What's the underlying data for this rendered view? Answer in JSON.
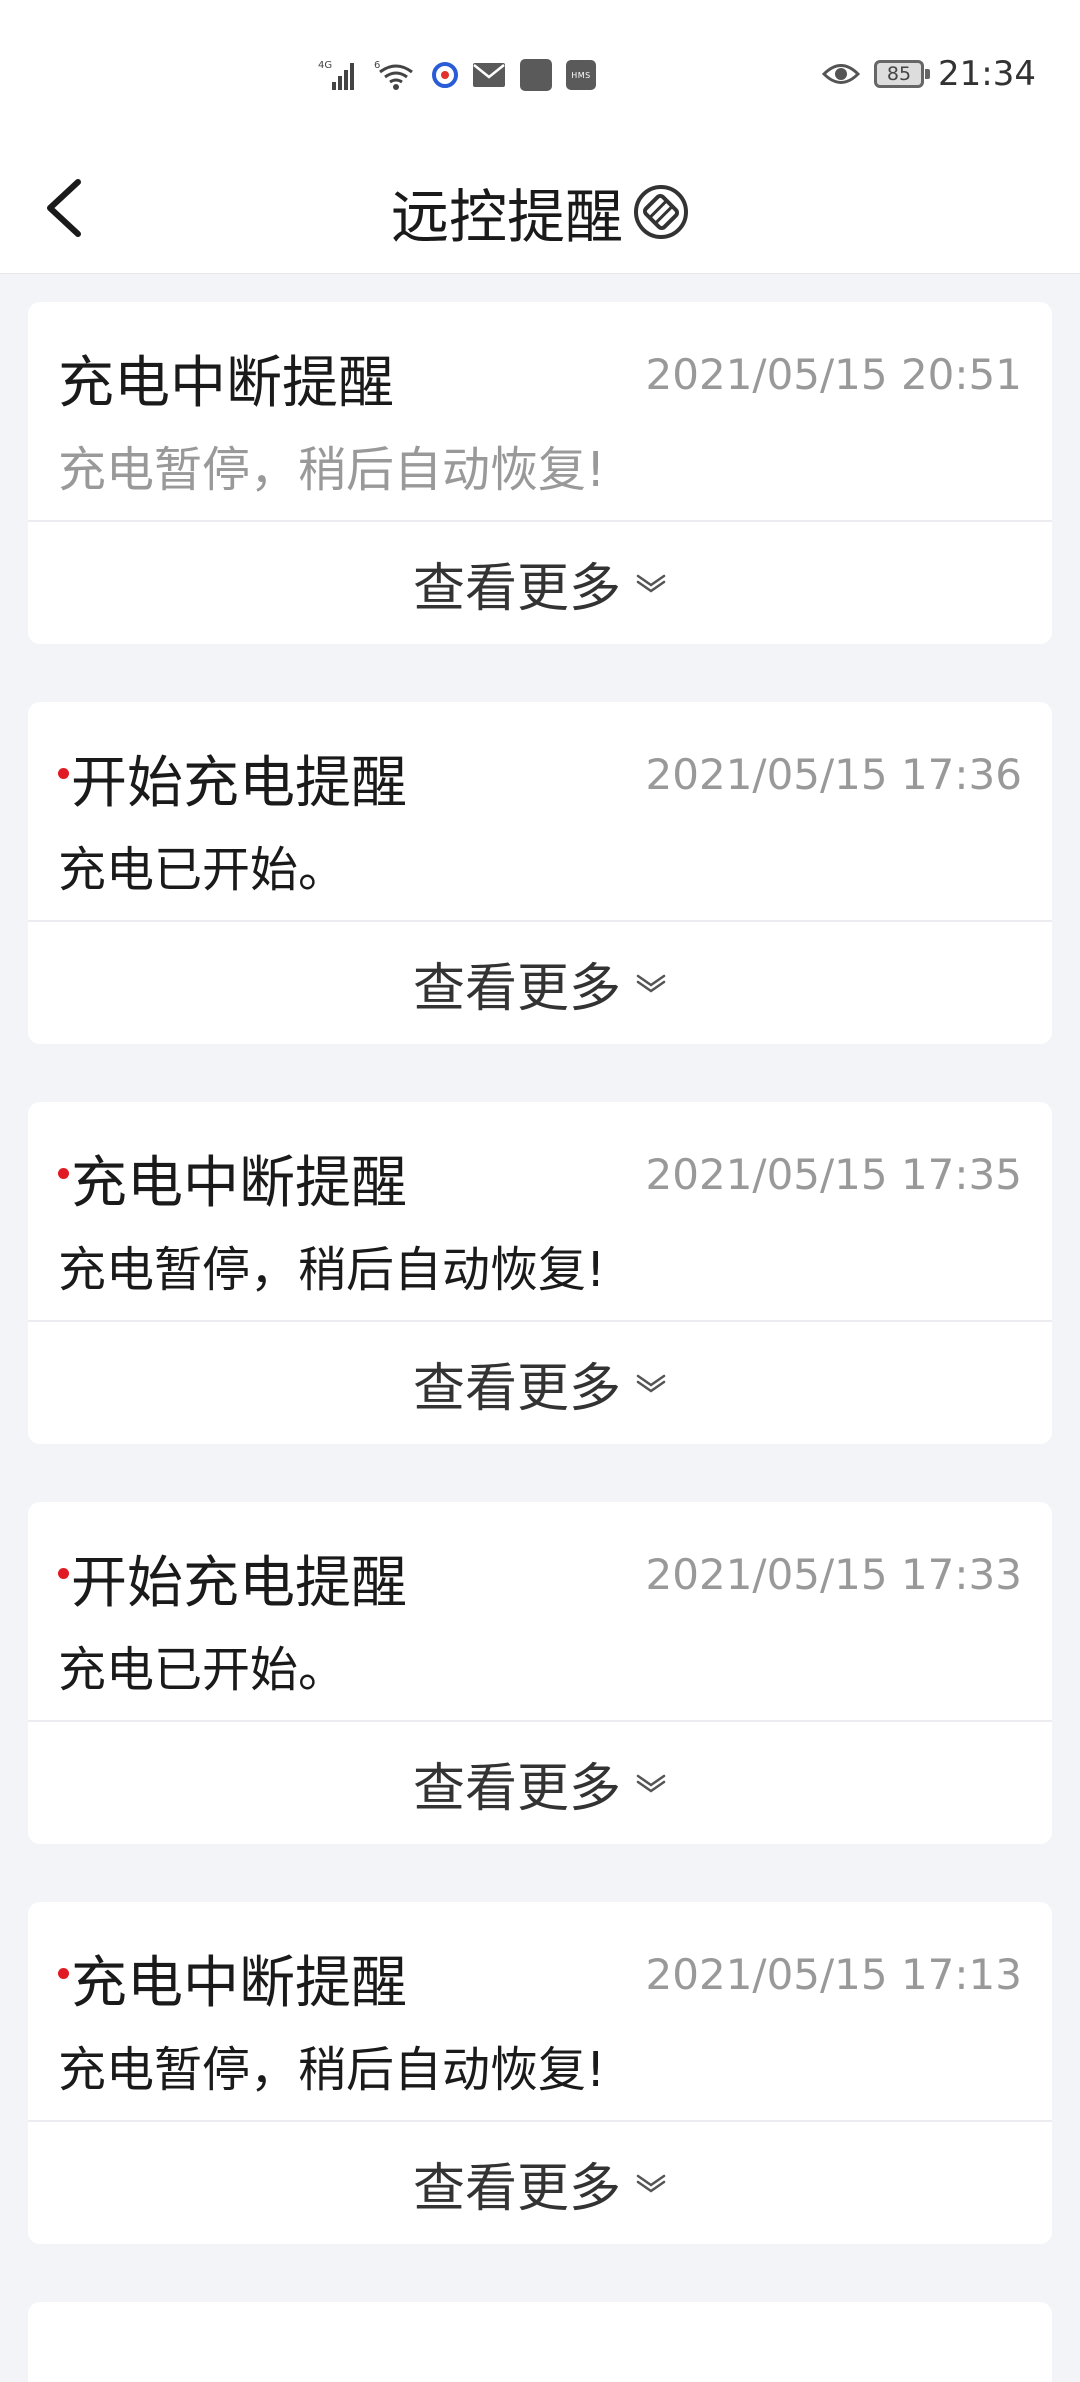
{
  "status_bar": {
    "network_label": "4G",
    "wifi_label": "6",
    "hms_label": "HMS",
    "battery_level": "85",
    "time": "21:34"
  },
  "header": {
    "title": "远控提醒"
  },
  "notifications": [
    {
      "title": "充电中断提醒",
      "time": "2021/05/15 20:51",
      "message": "充电暂停，稍后自动恢复!",
      "unread": false,
      "more_label": "查看更多"
    },
    {
      "title": "开始充电提醒",
      "time": "2021/05/15 17:36",
      "message": "充电已开始。",
      "unread": true,
      "more_label": "查看更多"
    },
    {
      "title": "充电中断提醒",
      "time": "2021/05/15 17:35",
      "message": "充电暂停，稍后自动恢复!",
      "unread": true,
      "more_label": "查看更多"
    },
    {
      "title": "开始充电提醒",
      "time": "2021/05/15 17:33",
      "message": "充电已开始。",
      "unread": true,
      "more_label": "查看更多"
    },
    {
      "title": "充电中断提醒",
      "time": "2021/05/15 17:13",
      "message": "充电暂停，稍后自动恢复!",
      "unread": true,
      "more_label": "查看更多"
    }
  ],
  "icons": {
    "back": "chevron-left-icon",
    "header_badge": "remote-control-icon",
    "expand": "chevron-down-icon",
    "unread_color": "#e01b24"
  }
}
